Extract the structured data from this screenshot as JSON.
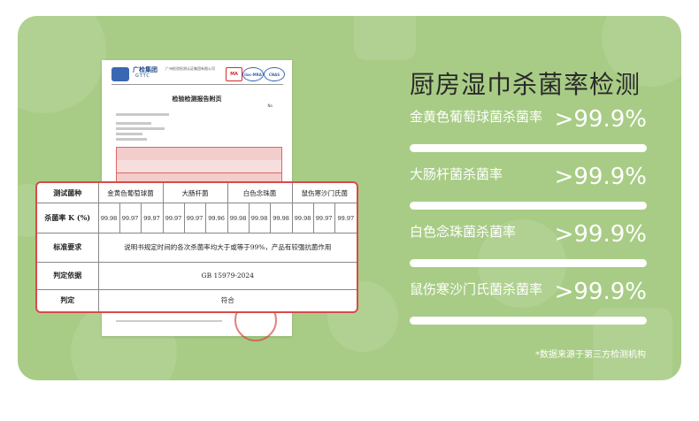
{
  "colors": {
    "panel_bg": "#a8cc85",
    "table_border": "#d84a4a",
    "text_dark": "#2a2a2a"
  },
  "heading": "厨房湿巾杀菌率检测",
  "results": [
    {
      "name": "金黄色葡萄球菌杀菌率",
      "value": ">99.9%",
      "fill": 1.0
    },
    {
      "name": "大肠杆菌杀菌率",
      "value": ">99.9%",
      "fill": 1.0
    },
    {
      "name": "白色念珠菌杀菌率",
      "value": ">99.9%",
      "fill": 1.0
    },
    {
      "name": "鼠伤寒沙门氏菌杀菌率",
      "value": ">99.9%",
      "fill": 1.0
    }
  ],
  "footnote": "*数据来源于第三方检测机构",
  "report": {
    "brand": "广检集团",
    "brand_en": "GTTC",
    "org_line": "广州检验检测认证集团有限公司",
    "seal_ma": "MA",
    "seal_ilac": "ilac-MRA",
    "seal_cnas": "CNAS",
    "title": "检验检测报告附页"
  },
  "table": {
    "header_label": "测试菌种",
    "strains": [
      "金黄色葡萄球菌",
      "大肠杆菌",
      "白色念珠菌",
      "鼠伤寒沙门氏菌"
    ],
    "rate_label": "杀菌率 K (%)",
    "rates": [
      [
        "99.98",
        "99.97",
        "99.97"
      ],
      [
        "99.97",
        "99.97",
        "99.96"
      ],
      [
        "99.98",
        "99.98",
        "99.98"
      ],
      [
        "99.98",
        "99.97",
        "99.97"
      ]
    ],
    "req_label": "标准要求",
    "req_text": "说明书规定时间的各次杀菌率均大于或等于99%，产品有较强抗菌作用",
    "basis_label": "判定依据",
    "basis_text": "GB 15979-2024",
    "verdict_label": "判定",
    "verdict_text": "符合"
  }
}
